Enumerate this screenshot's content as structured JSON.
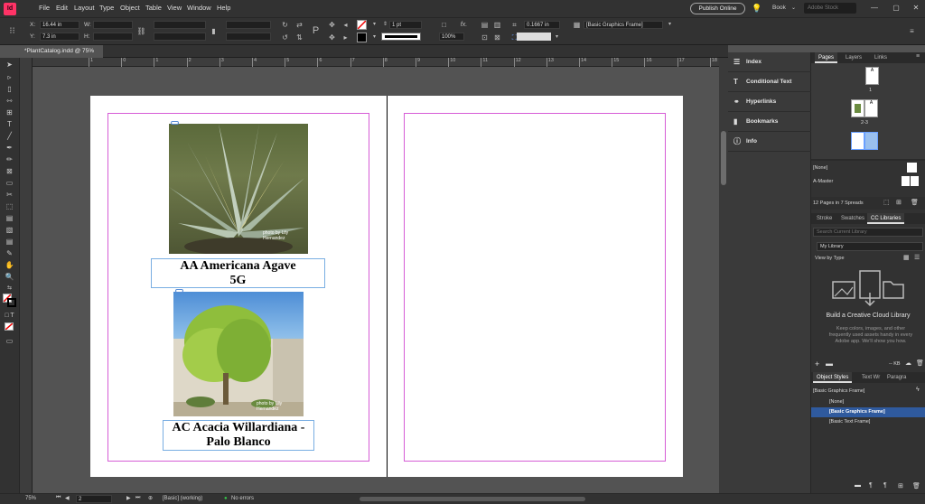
{
  "app": {
    "icon_text": "Id"
  },
  "menu": [
    "File",
    "Edit",
    "Layout",
    "Type",
    "Object",
    "Table",
    "View",
    "Window",
    "Help"
  ],
  "topbar": {
    "publish_label": "Publish Online",
    "workspace": "Book",
    "stock_placeholder": "Adobe Stock"
  },
  "control": {
    "x_label": "X:",
    "x_value": "16.44 in",
    "y_label": "Y:",
    "y_value": "7.3 in",
    "w_label": "W:",
    "h_label": "H:",
    "stroke_weight": "1 pt",
    "zoom_pct": "100%",
    "offset": "0.1667 in",
    "style": "[Basic Graphics Frame]"
  },
  "document": {
    "tab_title": "*PlantCatalog.indd @ 75%"
  },
  "ruler": {
    "h_marks": [
      "1",
      "0",
      "1",
      "2",
      "3",
      "4",
      "5",
      "6",
      "7",
      "8",
      "9",
      "10",
      "11",
      "12",
      "13",
      "14",
      "15",
      "16",
      "17",
      "18"
    ]
  },
  "page1": {
    "items": [
      {
        "caption": "AA Americana Agave 5G",
        "caption_line1": "AA Americana Agave",
        "caption_line2": "5G",
        "credit": "photo by Lily Hernandez"
      },
      {
        "caption_line1": "AC Acacia Willardiana -",
        "caption_line2": "Palo Blanco",
        "credit": "photo by Lily Hernandez"
      }
    ]
  },
  "collapsed_panels": [
    {
      "label": "Index",
      "icon": "index-icon",
      "glyph": "☰"
    },
    {
      "label": "Conditional Text",
      "icon": "conditional-text-icon",
      "glyph": "T"
    },
    {
      "label": "Hyperlinks",
      "icon": "hyperlinks-icon",
      "glyph": "⚭"
    },
    {
      "label": "Bookmarks",
      "icon": "bookmarks-icon",
      "glyph": "▮"
    },
    {
      "label": "Info",
      "icon": "info-icon",
      "glyph": "ⓘ"
    }
  ],
  "pages_panel": {
    "tabs": [
      "Pages",
      "Layers",
      "Links"
    ],
    "spreads": [
      "1",
      "2-3"
    ],
    "masters": [
      "[None]",
      "A-Master"
    ],
    "footer": "12 Pages in 7 Spreads"
  },
  "cc_panel": {
    "tabs": [
      "Stroke",
      "Swatches",
      "CC Libraries"
    ],
    "search_placeholder": "Search Current Library",
    "library": "My Library",
    "view_by": "View by Type",
    "heading": "Build a Creative Cloud Library",
    "body": "Keep colors, images, and other frequently used assets handy in every Adobe app. We'll show you how.",
    "size": "-- KB"
  },
  "styles_panel": {
    "tabs": [
      "Object Styles",
      "Text Wr",
      "Paragra"
    ],
    "current": "[Basic Graphics Frame]",
    "items": [
      "[None]",
      "[Basic Graphics Frame]",
      "[Basic Text Frame]"
    ]
  },
  "status": {
    "zoom": "75%",
    "page": "2",
    "style": "[Basic] (working)",
    "errors": "No errors"
  }
}
